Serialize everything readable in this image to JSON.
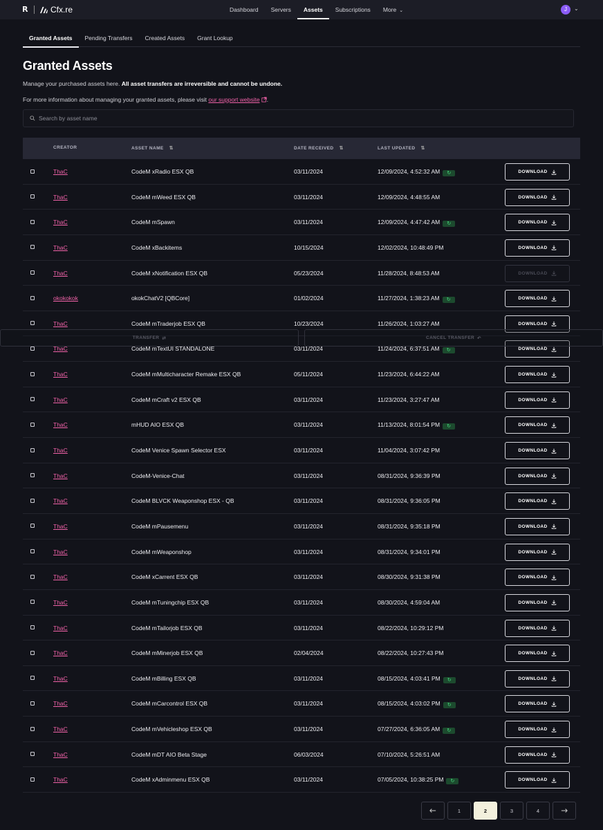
{
  "topbar": {
    "logo_r": "R",
    "logo_text": "Cfx.re",
    "nav": [
      "Dashboard",
      "Servers",
      "Assets",
      "Subscriptions",
      "More"
    ],
    "active_nav": "Assets",
    "avatar_initial": "J"
  },
  "tabs": [
    "Granted Assets",
    "Pending Transfers",
    "Created Assets",
    "Grant Lookup"
  ],
  "active_tab": "Granted Assets",
  "page": {
    "title": "Granted Assets",
    "desc_prefix": "Manage your purchased assets here. ",
    "desc_bold": "All asset transfers are irreversible and cannot be undone.",
    "info_prefix": "For more information about managing your granted assets, please visit ",
    "info_link": "our support website",
    "info_suffix": "."
  },
  "search": {
    "placeholder": "Search by asset name"
  },
  "table": {
    "headers": {
      "creator": "CREATOR",
      "asset_name": "ASSET NAME",
      "date_received": "DATE RECEIVED",
      "last_updated": "LAST UPDATED"
    },
    "download_label": "DOWNLOAD",
    "rows": [
      {
        "creator": "ThaC",
        "asset": "CodeM xRadio ESX QB",
        "received": "03/11/2024",
        "updated": "12/09/2024, 4:52:32 AM",
        "sync": true,
        "disabled": false
      },
      {
        "creator": "ThaC",
        "asset": "CodeM mWeed ESX QB",
        "received": "03/11/2024",
        "updated": "12/09/2024, 4:48:55 AM",
        "sync": false,
        "disabled": false
      },
      {
        "creator": "ThaC",
        "asset": "CodeM mSpawn",
        "received": "03/11/2024",
        "updated": "12/09/2024, 4:47:42 AM",
        "sync": true,
        "disabled": false
      },
      {
        "creator": "ThaC",
        "asset": "CodeM xBackitems",
        "received": "10/15/2024",
        "updated": "12/02/2024, 10:48:49 PM",
        "sync": false,
        "disabled": false
      },
      {
        "creator": "ThaC",
        "asset": "CodeM xNotification ESX QB",
        "received": "05/23/2024",
        "updated": "11/28/2024, 8:48:53 AM",
        "sync": false,
        "disabled": true
      },
      {
        "creator": "okokokok",
        "asset": "okokChatV2 [QBCore]",
        "received": "01/02/2024",
        "updated": "11/27/2024, 1:38:23 AM",
        "sync": true,
        "disabled": false
      },
      {
        "creator": "ThaC",
        "asset": "CodeM mTraderjob ESX QB",
        "received": "10/23/2024",
        "updated": "11/26/2024, 1:03:27 AM",
        "sync": false,
        "disabled": false
      },
      {
        "creator": "ThaC",
        "asset": "CodeM mTextUI STANDALONE",
        "received": "03/11/2024",
        "updated": "11/24/2024, 6:37:51 AM",
        "sync": true,
        "disabled": false
      },
      {
        "creator": "ThaC",
        "asset": "CodeM mMulticharacter Remake ESX QB",
        "received": "05/11/2024",
        "updated": "11/23/2024, 6:44:22 AM",
        "sync": false,
        "disabled": false
      },
      {
        "creator": "ThaC",
        "asset": "CodeM mCraft v2 ESX QB",
        "received": "03/11/2024",
        "updated": "11/23/2024, 3:27:47 AM",
        "sync": false,
        "disabled": false
      },
      {
        "creator": "ThaC",
        "asset": "mHUD AIO ESX QB",
        "received": "03/11/2024",
        "updated": "11/13/2024, 8:01:54 PM",
        "sync": true,
        "disabled": false
      },
      {
        "creator": "ThaC",
        "asset": "CodeM Venice Spawn Selector ESX",
        "received": "03/11/2024",
        "updated": "11/04/2024, 3:07:42 PM",
        "sync": false,
        "disabled": false
      },
      {
        "creator": "ThaC",
        "asset": "CodeM-Venice-Chat",
        "received": "03/11/2024",
        "updated": "08/31/2024, 9:36:39 PM",
        "sync": false,
        "disabled": false
      },
      {
        "creator": "ThaC",
        "asset": "CodeM BLVCK Weaponshop ESX - QB",
        "received": "03/11/2024",
        "updated": "08/31/2024, 9:36:05 PM",
        "sync": false,
        "disabled": false
      },
      {
        "creator": "ThaC",
        "asset": "CodeM mPausemenu",
        "received": "03/11/2024",
        "updated": "08/31/2024, 9:35:18 PM",
        "sync": false,
        "disabled": false
      },
      {
        "creator": "ThaC",
        "asset": "CodeM mWeaponshop",
        "received": "03/11/2024",
        "updated": "08/31/2024, 9:34:01 PM",
        "sync": false,
        "disabled": false
      },
      {
        "creator": "ThaC",
        "asset": "CodeM xCarrent ESX QB",
        "received": "03/11/2024",
        "updated": "08/30/2024, 9:31:38 PM",
        "sync": false,
        "disabled": false
      },
      {
        "creator": "ThaC",
        "asset": "CodeM mTuningchip ESX QB",
        "received": "03/11/2024",
        "updated": "08/30/2024, 4:59:04 AM",
        "sync": false,
        "disabled": false
      },
      {
        "creator": "ThaC",
        "asset": "CodeM mTailorjob ESX QB",
        "received": "03/11/2024",
        "updated": "08/22/2024, 10:29:12 PM",
        "sync": false,
        "disabled": false
      },
      {
        "creator": "ThaC",
        "asset": "CodeM mMinerjob ESX QB",
        "received": "02/04/2024",
        "updated": "08/22/2024, 10:27:43 PM",
        "sync": false,
        "disabled": false
      },
      {
        "creator": "ThaC",
        "asset": "CodeM mBilling ESX QB",
        "received": "03/11/2024",
        "updated": "08/15/2024, 4:03:41 PM",
        "sync": true,
        "disabled": false
      },
      {
        "creator": "ThaC",
        "asset": "CodeM mCarcontrol ESX QB",
        "received": "03/11/2024",
        "updated": "08/15/2024, 4:03:02 PM",
        "sync": true,
        "disabled": false
      },
      {
        "creator": "ThaC",
        "asset": "CodeM mVehicleshop ESX QB",
        "received": "03/11/2024",
        "updated": "07/27/2024, 6:36:05 AM",
        "sync": true,
        "disabled": false
      },
      {
        "creator": "ThaC",
        "asset": "CodeM mDT AIO Beta Stage",
        "received": "06/03/2024",
        "updated": "07/10/2024, 5:26:51 AM",
        "sync": false,
        "disabled": false
      },
      {
        "creator": "ThaC",
        "asset": "CodeM xAdminmenu ESX QB",
        "received": "03/11/2024",
        "updated": "07/05/2024, 10:38:25 PM",
        "sync": true,
        "disabled": false
      }
    ]
  },
  "transfer_bar": {
    "transfer_label": "TRANSFER",
    "cancel_label": "CANCEL TRANSFER"
  },
  "pagination": {
    "pages": [
      "1",
      "2",
      "3",
      "4"
    ],
    "current": "2"
  },
  "colors": {
    "accent": "#f062a8",
    "sync": "#4ade80",
    "active_page": "#f3f0dd",
    "avatar": "#8b5cf6"
  },
  "icons": {
    "sync": "refresh-icon",
    "download": "download-icon",
    "sort": "sort-icon",
    "search": "search-icon",
    "external": "external-link-icon"
  }
}
